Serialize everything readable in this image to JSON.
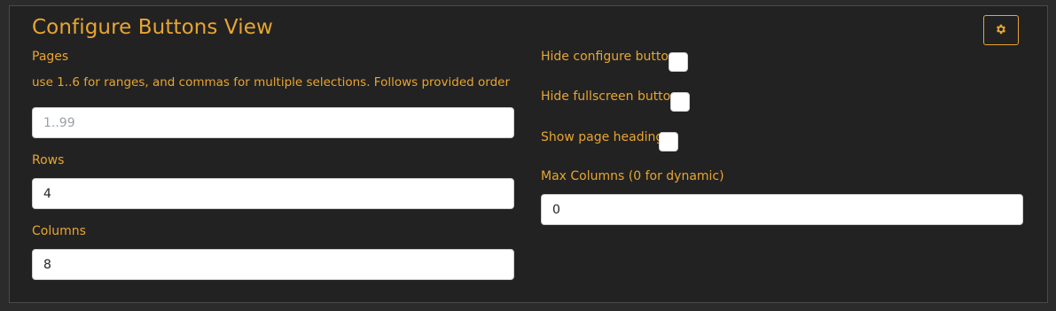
{
  "header": {
    "title": "Configure Buttons View",
    "settings_icon": "gear-icon"
  },
  "left": {
    "pages_label": "Pages",
    "pages_hint": "use 1..6 for ranges, and commas for multiple selections. Follows provided order",
    "pages_placeholder": "1..99",
    "pages_value": "",
    "rows_label": "Rows",
    "rows_value": "4",
    "columns_label": "Columns",
    "columns_value": "8"
  },
  "right": {
    "hide_configure_label": "Hide configure button",
    "hide_configure_checked": false,
    "hide_fullscreen_label": "Hide fullscreen button",
    "hide_fullscreen_checked": false,
    "show_headings_label": "Show page headings",
    "show_headings_checked": false,
    "max_columns_label": "Max Columns (0 for dynamic)",
    "max_columns_value": "0"
  },
  "colors": {
    "accent": "#e8a530",
    "panel_bg": "#222222",
    "page_bg": "#2b2b2b"
  }
}
